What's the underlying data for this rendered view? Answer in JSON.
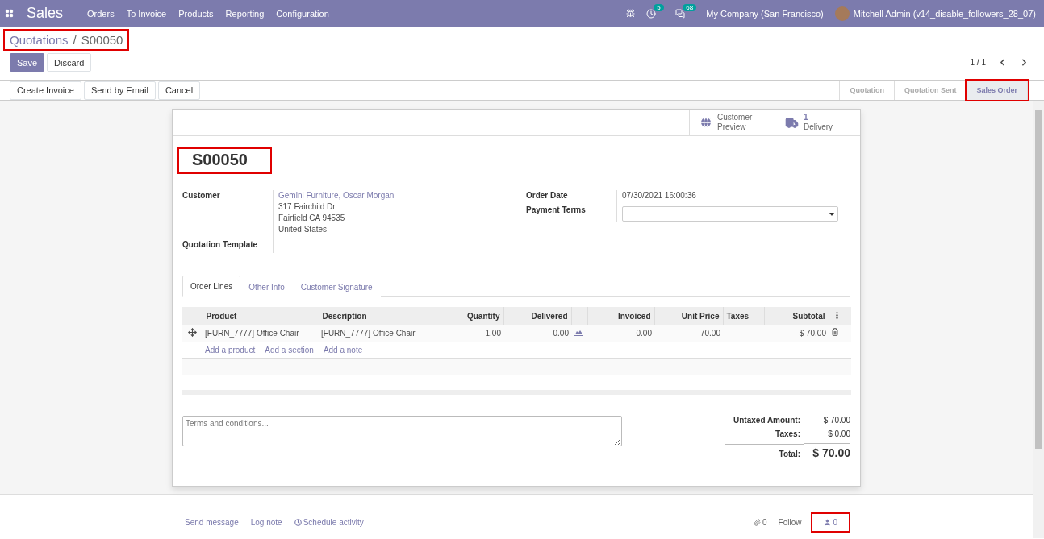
{
  "navbar": {
    "app": "Sales",
    "menu": [
      "Orders",
      "To Invoice",
      "Products",
      "Reporting",
      "Configuration"
    ],
    "activity_count": "5",
    "message_count": "68",
    "company": "My Company (San Francisco)",
    "user": "Mitchell Admin (v14_disable_followers_28_07)"
  },
  "breadcrumb": {
    "parent": "Quotations",
    "separator": "/",
    "current": "S00050",
    "highlighted": true
  },
  "form_buttons": [
    {
      "label": "Save",
      "kind": "primary"
    },
    {
      "label": "Discard",
      "kind": "secondary"
    }
  ],
  "pager": "1 / 1",
  "actions": [
    "Create Invoice",
    "Send by Email",
    "Cancel"
  ],
  "status_steps": [
    {
      "label": "Quotation",
      "selected": false,
      "highlighted": false
    },
    {
      "label": "Quotation Sent",
      "selected": false,
      "highlighted": false
    },
    {
      "label": "Sales Order",
      "selected": true,
      "highlighted": true
    }
  ],
  "smart_buttons": [
    {
      "kind": "preview",
      "label": "Customer",
      "label_2": "Preview"
    },
    {
      "kind": "delivery",
      "value": "1",
      "label": "Delivery"
    }
  ],
  "title": {
    "text": "S00050",
    "highlighted": true
  },
  "fields_left": [
    {
      "label": "Customer",
      "link": "Gemini Furniture, Oscar Morgan",
      "lines": [
        "317 Fairchild Dr",
        "Fairfield CA 94535",
        "United States"
      ]
    },
    {
      "label": "Quotation Template"
    }
  ],
  "fields_right": [
    {
      "kind": "text",
      "label": "Order Date",
      "value": "07/30/2021 16:00:36"
    },
    {
      "kind": "select",
      "label": "Payment Terms"
    }
  ],
  "tabs": [
    {
      "label": "Order Lines",
      "selected": true
    },
    {
      "label": "Other Info",
      "selected": false
    },
    {
      "label": "Customer Signature",
      "selected": false
    }
  ],
  "table": {
    "columns": [
      "Product",
      "Description",
      "Quantity",
      "Delivered",
      "Invoiced",
      "Unit Price",
      "Taxes",
      "Subtotal"
    ],
    "rows": [
      {
        "product": "[FURN_7777] Office Chair",
        "description": "[FURN_7777] Office Chair",
        "quantity": "1.00",
        "delivered": "0.00",
        "invoiced": "0.00",
        "unit_price": "70.00",
        "taxes": "",
        "subtotal": "$ 70.00"
      }
    ],
    "add_links": [
      "Add a product",
      "Add a section",
      "Add a note"
    ]
  },
  "terms": {
    "placeholder": "Terms and conditions..."
  },
  "totals": [
    {
      "label": "Untaxed Amount:",
      "value": "$ 70.00",
      "kind": "line"
    },
    {
      "label": "Taxes:",
      "value": "$ 0.00",
      "kind": "line"
    },
    {
      "label": "Total:",
      "value": "$ 70.00",
      "kind": "total"
    }
  ],
  "chatter": {
    "links": [
      {
        "label": "Send message",
        "kind": "plain"
      },
      {
        "label": "Log note",
        "kind": "plain"
      },
      {
        "label": "Schedule activity",
        "kind": "clock"
      }
    ],
    "attachments": "0",
    "follow": "Follow",
    "followers": "0",
    "followers_highlighted": true
  }
}
